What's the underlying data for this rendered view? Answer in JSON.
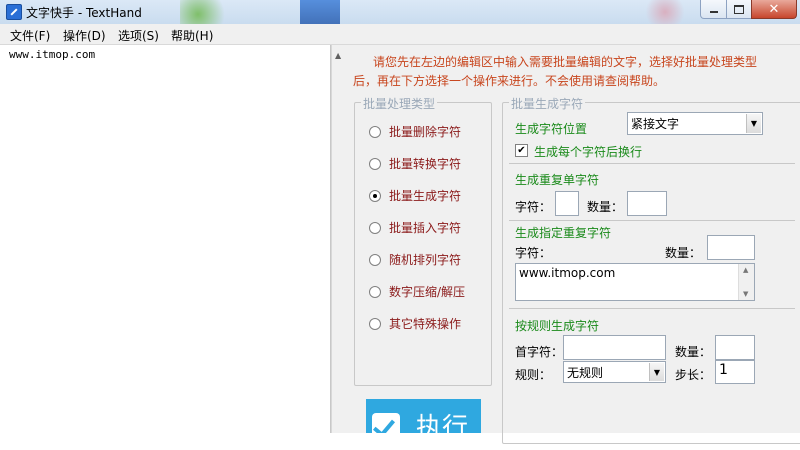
{
  "window": {
    "title": "文字快手 - TextHand",
    "close_glyph": "✕"
  },
  "menu": [
    "文件(F)",
    "操作(D)",
    "选项(S)",
    "帮助(H)"
  ],
  "editor": {
    "content": "www.itmop.com"
  },
  "hint": "请您先在左边的编辑区中输入需要批量编辑的文字，选择好批量处理类型后，再在下方选择一个操作来进行。不会使用请查阅帮助。",
  "process_types": {
    "title": "批量处理类型",
    "selected_index": 2,
    "items": [
      "批量删除字符",
      "批量转换字符",
      "批量生成字符",
      "批量插入字符",
      "随机排列字符",
      "数字压缩/解压",
      "其它特殊操作"
    ]
  },
  "generate": {
    "title": "批量生成字符",
    "position": {
      "label": "生成字符位置",
      "value": "紧接文字"
    },
    "newline": {
      "label": "生成每个字符后换行",
      "checked": true
    },
    "repeat_single": {
      "title": "生成重复单字符",
      "char_label": "字符：",
      "char_value": "",
      "count_label": "数量：",
      "count_value": ""
    },
    "repeat_specified": {
      "title": "生成指定重复字符",
      "char_label": "字符：",
      "count_label": "数量：",
      "count_value": "",
      "text_value": "www.itmop.com"
    },
    "rule": {
      "title": "按规则生成字符",
      "first_label": "首字符：",
      "first_value": "",
      "count_label": "数量：",
      "count_value": "",
      "rule_label": "规则：",
      "rule_value": "无规则",
      "step_label": "步长：",
      "step_value": "1"
    }
  },
  "execute": {
    "label": "执行"
  },
  "colors": {
    "hint_text": "#c8461e",
    "radio_text": "#8b1a1a",
    "section_title": "#1a8a1a",
    "exec_button": "#2fa8e0"
  },
  "icons": {
    "app": "app-icon",
    "minimize": "minimize-icon",
    "maximize": "maximize-icon",
    "close": "close-icon",
    "dropdown": "chevron-down-icon",
    "execute": "check-icon"
  }
}
